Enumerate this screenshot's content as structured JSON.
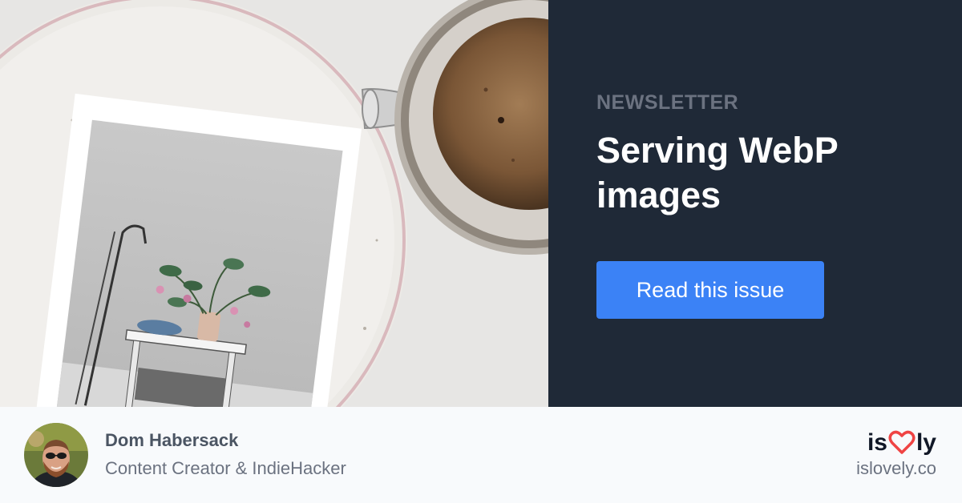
{
  "hero": {
    "image_alt": "Magazine on a white plate next to a cup of coffee"
  },
  "panel": {
    "eyebrow": "NEWSLETTER",
    "title": "Serving WebP images",
    "cta_label": "Read this issue"
  },
  "author": {
    "name": "Dom Habersack",
    "role": "Content Creator & IndieHacker"
  },
  "brand": {
    "logo_prefix": "is",
    "logo_icon": "heart-icon",
    "logo_suffix": "ly",
    "site": "islovely.co"
  },
  "colors": {
    "panel_bg": "#1f2937",
    "accent_blue": "#3b82f6",
    "heart_red": "#ef4444",
    "footer_bg": "#f8fafc"
  }
}
